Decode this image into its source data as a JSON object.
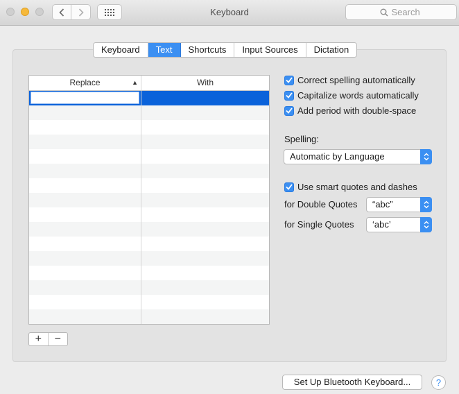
{
  "window": {
    "title": "Keyboard",
    "search_placeholder": "Search"
  },
  "tabs": [
    {
      "label": "Keyboard",
      "active": false
    },
    {
      "label": "Text",
      "active": true
    },
    {
      "label": "Shortcuts",
      "active": false
    },
    {
      "label": "Input Sources",
      "active": false
    },
    {
      "label": "Dictation",
      "active": false
    }
  ],
  "table": {
    "columns": [
      "Replace",
      "With"
    ],
    "sort_indicator": "▲",
    "rows": [
      {
        "replace": "",
        "with": "",
        "selected": true
      },
      {
        "replace": "",
        "with": ""
      },
      {
        "replace": "",
        "with": ""
      },
      {
        "replace": "",
        "with": ""
      },
      {
        "replace": "",
        "with": ""
      },
      {
        "replace": "",
        "with": ""
      },
      {
        "replace": "",
        "with": ""
      },
      {
        "replace": "",
        "with": ""
      },
      {
        "replace": "",
        "with": ""
      },
      {
        "replace": "",
        "with": ""
      },
      {
        "replace": "",
        "with": ""
      },
      {
        "replace": "",
        "with": ""
      },
      {
        "replace": "",
        "with": ""
      },
      {
        "replace": "",
        "with": ""
      },
      {
        "replace": "",
        "with": ""
      },
      {
        "replace": "",
        "with": ""
      }
    ],
    "add_label": "+",
    "remove_label": "−"
  },
  "options": {
    "correct_spelling": {
      "label": "Correct spelling automatically",
      "checked": true
    },
    "capitalize_words": {
      "label": "Capitalize words automatically",
      "checked": true
    },
    "add_period": {
      "label": "Add period with double-space",
      "checked": true
    },
    "spelling_label": "Spelling:",
    "spelling_value": "Automatic by Language",
    "smart_quotes": {
      "label": "Use smart quotes and dashes",
      "checked": true
    },
    "double_quotes_label": "for Double Quotes",
    "double_quotes_value": "“abc”",
    "single_quotes_label": "for Single Quotes",
    "single_quotes_value": "‘abc’"
  },
  "footer": {
    "bluetooth_button": "Set Up Bluetooth Keyboard...",
    "help_label": "?"
  },
  "colors": {
    "accent": "#3b8ff2",
    "selection": "#0a62da"
  },
  "icons": {
    "back": "chevron-left-icon",
    "forward": "chevron-right-icon",
    "grid": "grid-icon",
    "search": "search-icon"
  }
}
